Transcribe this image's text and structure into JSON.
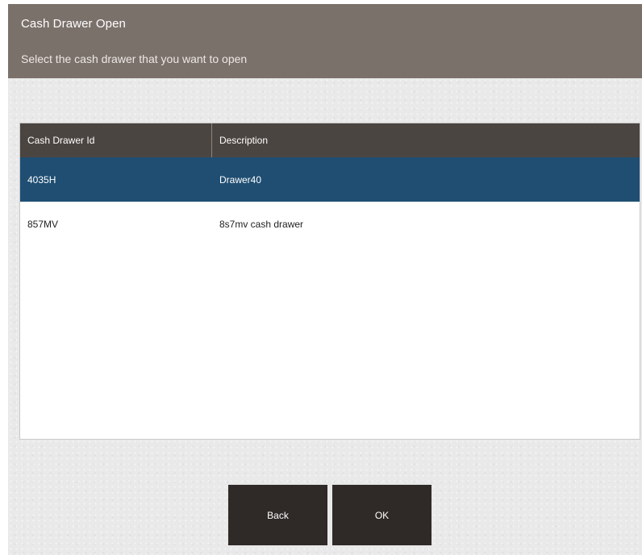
{
  "header": {
    "title": "Cash Drawer Open",
    "subtitle": "Select the cash drawer that you want to open"
  },
  "table": {
    "columns": [
      "Cash Drawer Id",
      "Description"
    ],
    "rows": [
      {
        "id": "4035H",
        "description": "Drawer40",
        "selected": true
      },
      {
        "id": "857MV",
        "description": "8s7mv cash drawer",
        "selected": false
      }
    ]
  },
  "buttons": {
    "back_label": "Back",
    "ok_label": "OK"
  },
  "colors": {
    "header_bg": "#7b716b",
    "table_header_bg": "#4b4541",
    "selected_row_bg": "#1f4e72",
    "button_bg": "#2f2a27"
  }
}
